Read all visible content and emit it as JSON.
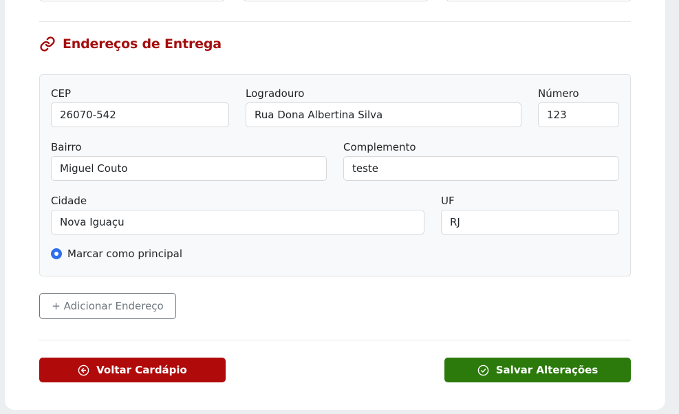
{
  "section": {
    "title": "Endereços de Entrega",
    "icon": "link-icon",
    "accent_color": "#a50e0e"
  },
  "address": {
    "cep": {
      "label": "CEP",
      "value": "26070-542"
    },
    "logradouro": {
      "label": "Logradouro",
      "value": "Rua Dona Albertina Silva"
    },
    "numero": {
      "label": "Número",
      "value": "123"
    },
    "bairro": {
      "label": "Bairro",
      "value": "Miguel Couto"
    },
    "complemento": {
      "label": "Complemento",
      "value": "teste"
    },
    "cidade": {
      "label": "Cidade",
      "value": "Nova Iguaçu"
    },
    "uf": {
      "label": "UF",
      "value": "RJ"
    },
    "principal": {
      "label": "Marcar como principal",
      "checked": true
    }
  },
  "actions": {
    "add_address_label": "+ Adicionar Endereço",
    "back_label": "Voltar Cardápio",
    "back_icon": "arrow-left-circle-icon",
    "back_color": "#b00a0a",
    "save_label": "Salvar Alterações",
    "save_icon": "check-circle-icon",
    "save_color": "#2b7a0b"
  }
}
